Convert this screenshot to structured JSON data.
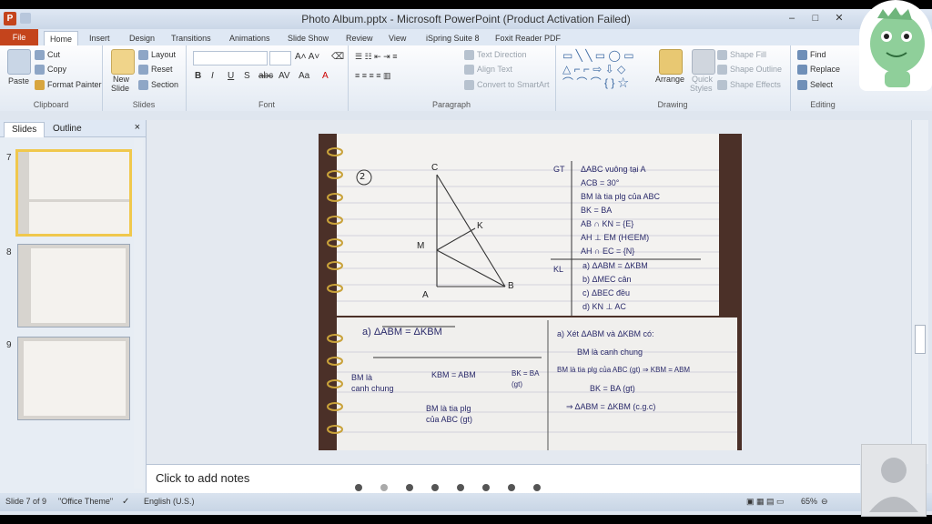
{
  "window": {
    "title": "Photo Album.pptx - Microsoft PowerPoint (Product Activation Failed)",
    "app_icon_letter": "P",
    "controls": [
      "–",
      "□",
      "✕"
    ]
  },
  "tabs": [
    "File",
    "Home",
    "Insert",
    "Design",
    "Transitions",
    "Animations",
    "Slide Show",
    "Review",
    "View",
    "iSpring Suite 8",
    "Foxit Reader PDF"
  ],
  "active_tab": "Home",
  "ribbon": {
    "clipboard": {
      "paste": "Paste",
      "cut": "Cut",
      "copy": "Copy",
      "format_painter": "Format Painter",
      "label": "Clipboard"
    },
    "slides": {
      "new_slide": "New",
      "new_slide2": "Slide",
      "layout": "Layout",
      "reset": "Reset",
      "section": "Section",
      "label": "Slides"
    },
    "font": {
      "label": "Font",
      "buttons": [
        "B",
        "I",
        "U",
        "S",
        "abc",
        "AV",
        "Aa",
        "A"
      ]
    },
    "paragraph": {
      "text_direction": "Text Direction",
      "align_text": "Align Text",
      "convert_smartart": "Convert to SmartArt",
      "label": "Paragraph"
    },
    "drawing": {
      "arrange": "Arrange",
      "quick_styles": "Quick",
      "quick_styles2": "Styles",
      "shape_fill": "Shape Fill",
      "shape_outline": "Shape Outline",
      "shape_effects": "Shape Effects",
      "label": "Drawing"
    },
    "editing": {
      "find": "Find",
      "replace": "Replace",
      "select": "Select",
      "label": "Editing"
    }
  },
  "left_pane": {
    "tabs": [
      "Slides",
      "Outline"
    ],
    "close": "×",
    "slides": [
      {
        "num": "7",
        "selected": true
      },
      {
        "num": "8",
        "selected": false
      },
      {
        "num": "9",
        "selected": false
      }
    ]
  },
  "slide": {
    "problem_number": "2",
    "given_label": "GT",
    "given": [
      "ΔABC vuông tại A",
      "ACB = 30°",
      "BM là tia plg của ABC",
      "BK = BA",
      "AB ∩ KN = {E}",
      "AH ⊥ EM (H∈EM)",
      "AH ∩ EC = {N}"
    ],
    "conclusion_label": "KL",
    "conclusion": [
      "a) ΔABM = ΔKBM",
      "b) ΔMEC cân",
      "c) ΔBEC đều",
      "d) KN ⊥ AC"
    ],
    "figure_labels": {
      "C": "C",
      "K": "K",
      "M": "M",
      "A": "A",
      "B": "B"
    },
    "part_a_title": "a)  ΔABM = ΔKBM",
    "part_a_left": [
      "BM là",
      "canh chung"
    ],
    "part_a_mid": "KBM = ABM",
    "part_a_right": "BK = BA",
    "part_a_right_note": "(gt)",
    "part_a_bottom": [
      "BM là tia plg",
      "của ABC (gt)"
    ],
    "proof": [
      "a)  Xét ΔABM và ΔKBM có:",
      "BM là canh chung",
      "BM là tia plg của ABC (gt) ⇒ KBM = ABM",
      "BK = BA (gt)",
      "⇒ ΔABM = ΔKBM (c.g.c)"
    ]
  },
  "notes_placeholder": "Click to add notes",
  "status": {
    "slide_of": "Slide 7 of 9",
    "theme": "\"Office Theme\"",
    "language": "English (U.S.)",
    "zoom": "65%"
  },
  "colors": {
    "file_tab": "#c4441c",
    "selection": "#f0c84c",
    "ribbon_bg": "#e3eaf3"
  }
}
